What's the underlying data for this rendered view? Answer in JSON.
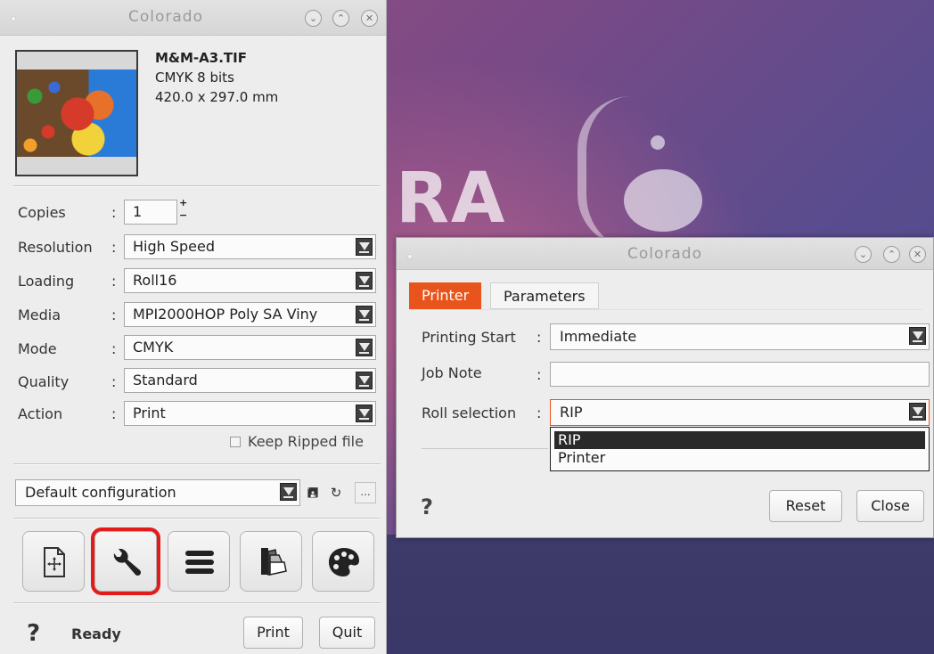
{
  "main_window": {
    "title": "Colorado",
    "file": {
      "name": "M&M-A3.TIF",
      "color_mode": "CMYK 8 bits",
      "dimensions": "420.0 x 297.0 mm"
    },
    "copies": {
      "label": "Copies",
      "value": "1"
    },
    "resolution": {
      "label": "Resolution",
      "value": "High Speed"
    },
    "loading": {
      "label": "Loading",
      "value": "Roll16"
    },
    "media": {
      "label": "Media",
      "value": "MPI2000HOP Poly SA Viny"
    },
    "mode": {
      "label": "Mode",
      "value": "CMYK"
    },
    "quality": {
      "label": "Quality",
      "value": "Standard"
    },
    "action": {
      "label": "Action",
      "value": "Print"
    },
    "keep_ripped": {
      "label": "Keep Ripped file",
      "checked": false
    },
    "configuration": {
      "value": "Default configuration",
      "more_label": "..."
    },
    "toolbar": [
      {
        "name": "layout-icon",
        "selected": false
      },
      {
        "name": "wrench-icon",
        "selected": true
      },
      {
        "name": "list-icon",
        "selected": false
      },
      {
        "name": "swatch-icon",
        "selected": false
      },
      {
        "name": "palette-icon",
        "selected": false
      }
    ],
    "status": {
      "help": "?",
      "text": "Ready"
    },
    "buttons": {
      "print": "Print",
      "quit": "Quit"
    },
    "colon": ":"
  },
  "dialog": {
    "title": "Colorado",
    "tabs": [
      {
        "label": "Printer",
        "active": true
      },
      {
        "label": "Parameters",
        "active": false
      }
    ],
    "printing_start": {
      "label": "Printing Start",
      "value": "Immediate"
    },
    "job_note": {
      "label": "Job Note",
      "value": ""
    },
    "roll_selection": {
      "label": "Roll selection",
      "value": "RIP",
      "options": [
        "RIP",
        "Printer"
      ],
      "selected_index": 0
    },
    "help": "?",
    "buttons": {
      "reset": "Reset",
      "close": "Close"
    },
    "colon": ":"
  },
  "colors": {
    "accent": "#e8541b",
    "selection_outline": "#e21b1b",
    "window_bg": "#ededed"
  }
}
